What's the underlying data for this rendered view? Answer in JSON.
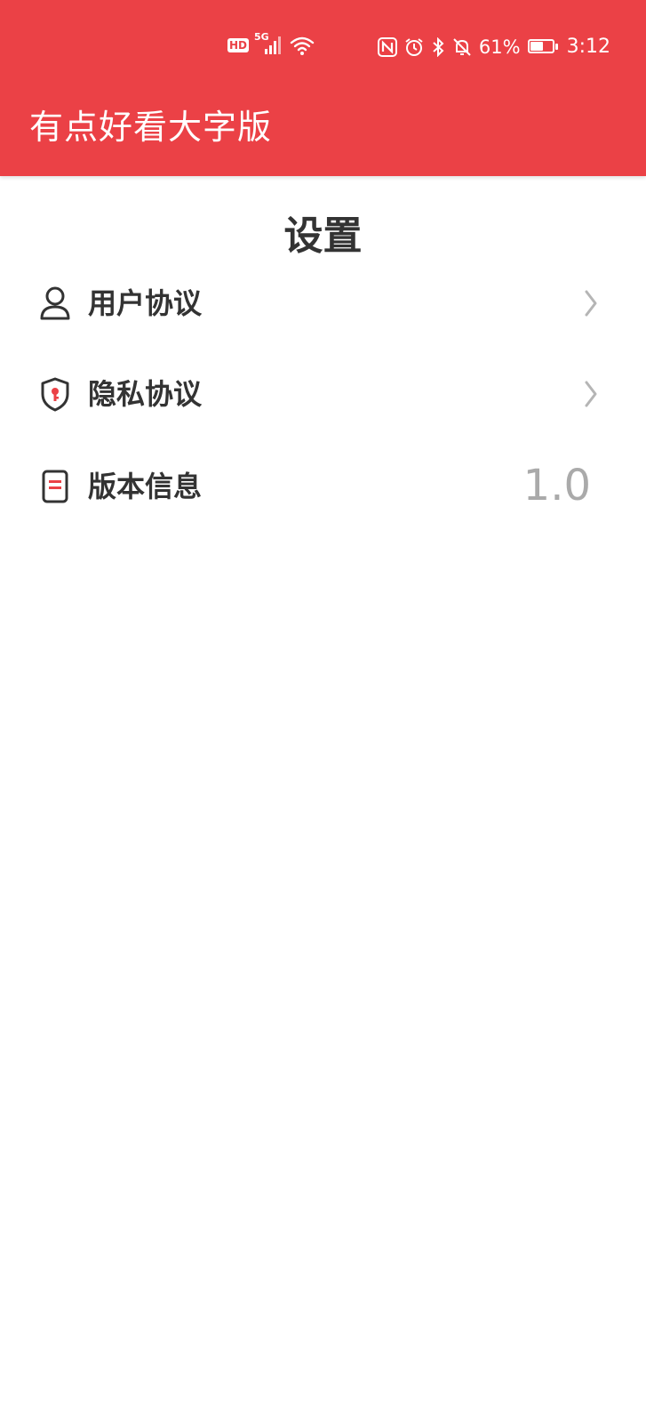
{
  "status_bar": {
    "left_icons": [
      "hd-icon",
      "signal-5g-icon",
      "wifi-icon"
    ],
    "hd_label": "HD",
    "network_label": "5G",
    "right_icons": [
      "nfc-icon",
      "alarm-icon",
      "bluetooth-icon",
      "mute-icon"
    ],
    "battery_percent": "61%",
    "battery_level": 0.61,
    "time": "3:12"
  },
  "header": {
    "app_title": "有点好看大字版",
    "background_color": "#EB4146"
  },
  "page": {
    "title": "设置"
  },
  "settings": {
    "items": [
      {
        "label": "用户协议",
        "icon": "user-icon",
        "trailing": "chevron-right-icon"
      },
      {
        "label": "隐私协议",
        "icon": "shield-lock-icon",
        "trailing": "chevron-right-icon"
      },
      {
        "label": "版本信息",
        "icon": "document-icon",
        "value": "1.0"
      }
    ]
  },
  "colors": {
    "accent": "#EB4146",
    "text_primary": "#333333",
    "text_secondary": "#AAAAAA"
  }
}
